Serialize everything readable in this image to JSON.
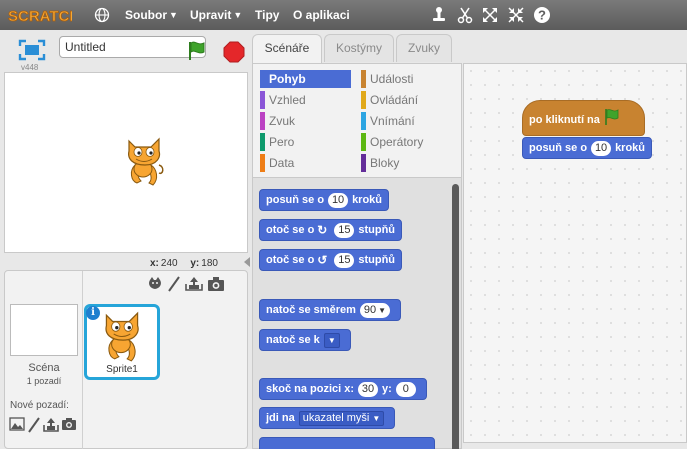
{
  "app": {
    "logo_text": "SCRATCH",
    "version": "v448"
  },
  "menu": {
    "items": [
      "Soubor",
      "Upravit",
      "Tipy",
      "O aplikaci"
    ]
  },
  "stage": {
    "project_title": "Untitled",
    "coords": {
      "x_label": "x:",
      "x_value": "240",
      "y_label": "y:",
      "y_value": "180"
    }
  },
  "sprites": {
    "scene_label": "Scéna",
    "scene_backdrops": "1 pozadí",
    "new_backdrop_label": "Nové pozadí:",
    "items": [
      {
        "name": "Sprite1",
        "info": "i"
      }
    ]
  },
  "tabs": [
    "Scénáře",
    "Kostýmy",
    "Zvuky"
  ],
  "categories": [
    {
      "label": "Pohyb",
      "color": "#4a6cd4",
      "active": true
    },
    {
      "label": "Vzhled",
      "color": "#8a55d7"
    },
    {
      "label": "Zvuk",
      "color": "#bb42c3"
    },
    {
      "label": "Pero",
      "color": "#0e9a6c"
    },
    {
      "label": "Data",
      "color": "#ee7d16"
    },
    {
      "label": "Události",
      "color": "#c88330"
    },
    {
      "label": "Ovládání",
      "color": "#e1a91a"
    },
    {
      "label": "Vnímání",
      "color": "#2ca5e2"
    },
    {
      "label": "Operátory",
      "color": "#5cb712"
    },
    {
      "label": "Bloky",
      "color": "#632d99"
    }
  ],
  "blocks": {
    "move": {
      "pre": "posuň se o",
      "value": "10",
      "post": "kroků"
    },
    "turn_right": {
      "pre": "otoč se o",
      "value": "15",
      "post": "stupňů"
    },
    "turn_left": {
      "pre": "otoč se o",
      "value": "15",
      "post": "stupňů"
    },
    "point_direction": {
      "pre": "natoč se směrem",
      "value": "90"
    },
    "point_towards": {
      "pre": "natoč se k"
    },
    "goto_xy": {
      "pre": "skoč na pozici x:",
      "x": "30",
      "y_label": "y:",
      "y": "0"
    },
    "goto": {
      "pre": "jdi na",
      "value": "ukazatel myši"
    }
  },
  "script": {
    "hat_label": "po kliknutí na",
    "move": {
      "pre": "posuň se o",
      "value": "10",
      "post": "kroků"
    }
  }
}
